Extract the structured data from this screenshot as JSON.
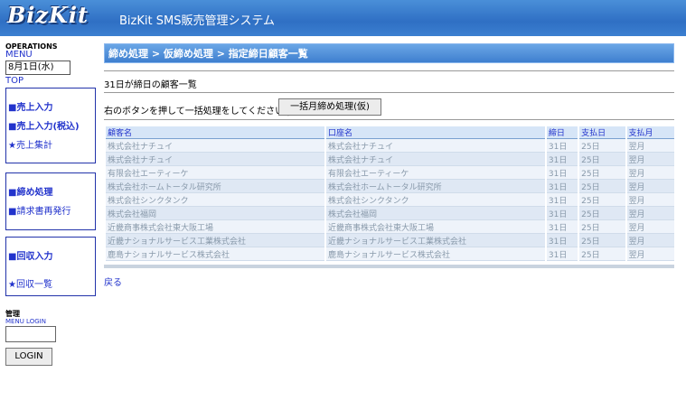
{
  "app": {
    "logo": "BizKit",
    "title": "BizKit SMS販売管理システム"
  },
  "sidebar": {
    "operations_label": "OPERATIONS",
    "menu_label": "MENU",
    "date": "8月1日(水)",
    "top_link": "TOP",
    "group1": [
      "■売上入力",
      "■売上入力(税込)",
      "★売上集計"
    ],
    "group2": [
      "■締め処理",
      "■請求書再発行"
    ],
    "group3": [
      "■回収入力",
      "★回収一覧"
    ],
    "admin_label": "管理",
    "menu_login_label": "MENU LOGIN",
    "login_button": "LOGIN"
  },
  "main": {
    "breadcrumb": "締め処理 > 仮締め処理 > 指定締日顧客一覧",
    "subtitle": "31日が締日の顧客一覧",
    "instruction": "右のボタンを押して一括処理をしてください |",
    "bulk_button": "一括月締め処理(仮)",
    "table": {
      "headers": [
        "顧客名",
        "口座名",
        "締日",
        "支払日",
        "支払月"
      ],
      "rows": [
        [
          "株式会社ナチュイ",
          "株式会社ナチュイ",
          "31日",
          "25日",
          "翌月"
        ],
        [
          "株式会社ナチュイ",
          "株式会社ナチュイ",
          "31日",
          "25日",
          "翌月"
        ],
        [
          "有限会社エーティーケ",
          "有限会社エーティーケ",
          "31日",
          "25日",
          "翌月"
        ],
        [
          "株式会社ホームトータル研究所",
          "株式会社ホームトータル研究所",
          "31日",
          "25日",
          "翌月"
        ],
        [
          "株式会社シンクタンク",
          "株式会社シンクタンク",
          "31日",
          "25日",
          "翌月"
        ],
        [
          "株式会社福岡",
          "株式会社福岡",
          "31日",
          "25日",
          "翌月"
        ],
        [
          "近畿商事株式会社東大阪工場",
          "近畿商事株式会社東大阪工場",
          "31日",
          "25日",
          "翌月"
        ],
        [
          "近畿ナショナルサービス工業株式会社",
          "近畿ナショナルサービス工業株式会社",
          "31日",
          "25日",
          "翌月"
        ],
        [
          "鹿島ナショナルサービス株式会社",
          "鹿島ナショナルサービス株式会社",
          "31日",
          "25日",
          "翌月"
        ]
      ]
    },
    "back_link": "戻る"
  },
  "colors": {
    "accent": "#2f6fc4",
    "link": "#2233cc",
    "header_bar": "#3f7fcf"
  }
}
